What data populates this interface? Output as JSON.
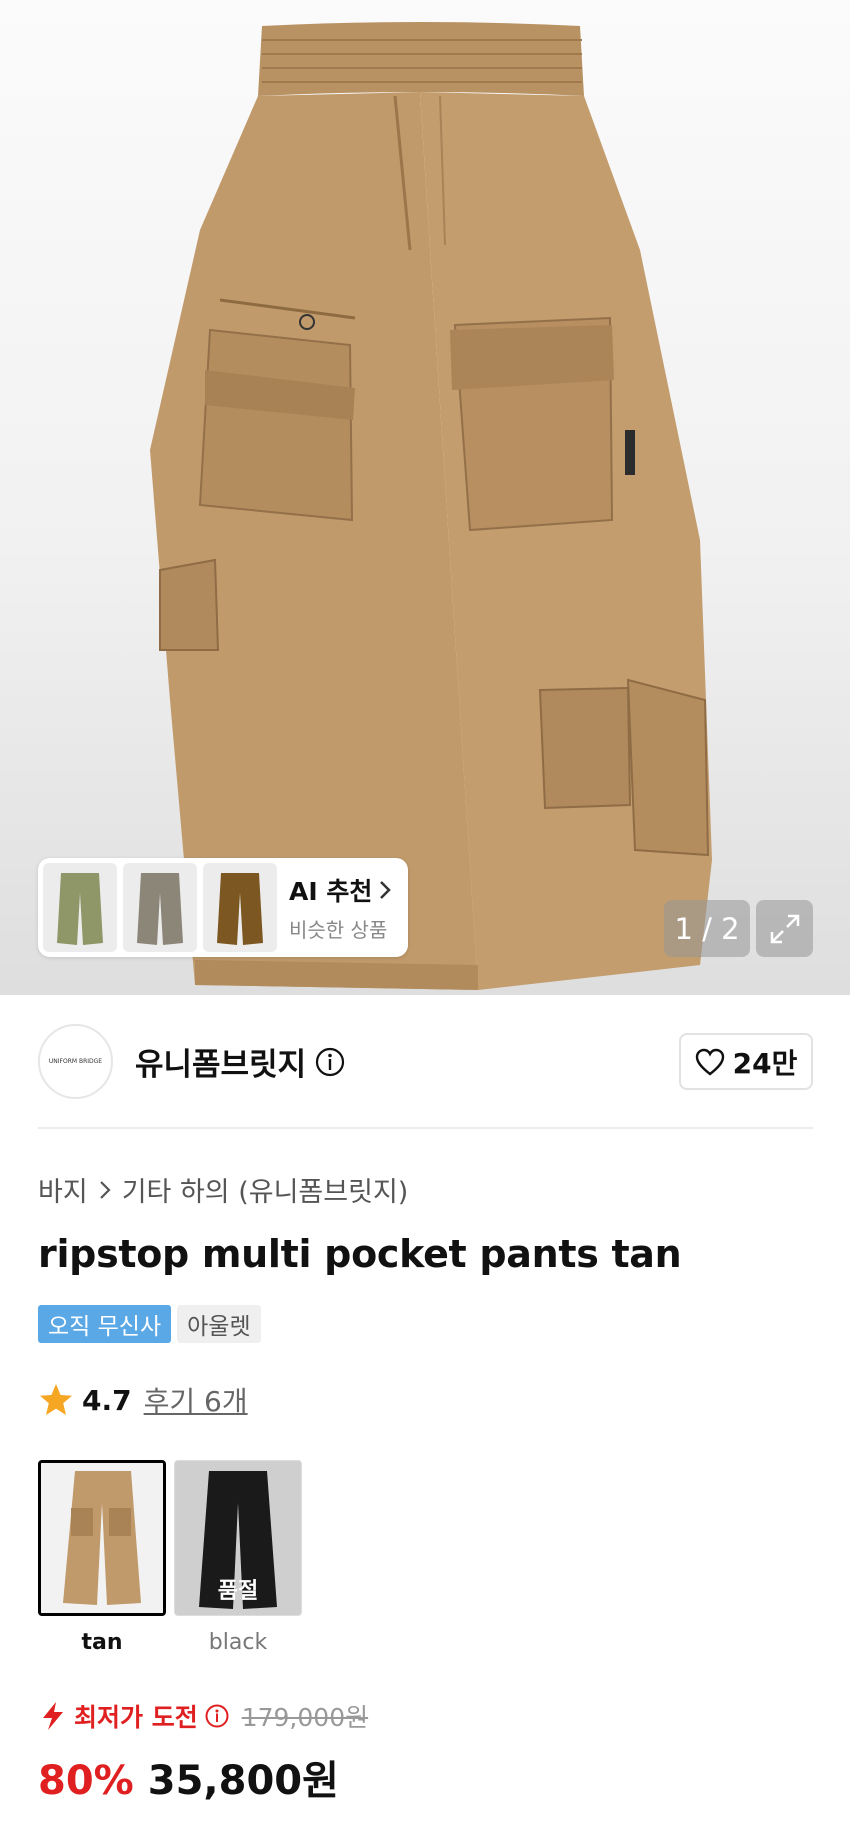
{
  "gallery": {
    "counter": "1 / 2",
    "ai_card": {
      "title": "AI 추천",
      "subtitle": "비슷한 상품"
    }
  },
  "brand": {
    "name": "유니폼브릿지",
    "logo_text": "UNIFORM BRIDGE",
    "likes": "24만"
  },
  "breadcrumb": {
    "category": "바지",
    "subcategory": "기타 하의 (유니폼브릿지)"
  },
  "product": {
    "title": "ripstop multi pocket pants tan",
    "badges": [
      "오직 무신사",
      "아울렛"
    ],
    "rating": "4.7",
    "reviews": "후기 6개"
  },
  "options": [
    {
      "label": "tan",
      "selected": true,
      "sold_out": false
    },
    {
      "label": "black",
      "selected": false,
      "sold_out": true,
      "sold_out_text": "품절"
    }
  ],
  "price": {
    "low_price_label": "최저가 도전",
    "original_price": "179,000원",
    "discount": "80%",
    "sale_price": "35,800원"
  },
  "colors": {
    "accent_red": "#e02020",
    "badge_blue": "#5aa8e6",
    "product_tan": "#c09a6b"
  }
}
